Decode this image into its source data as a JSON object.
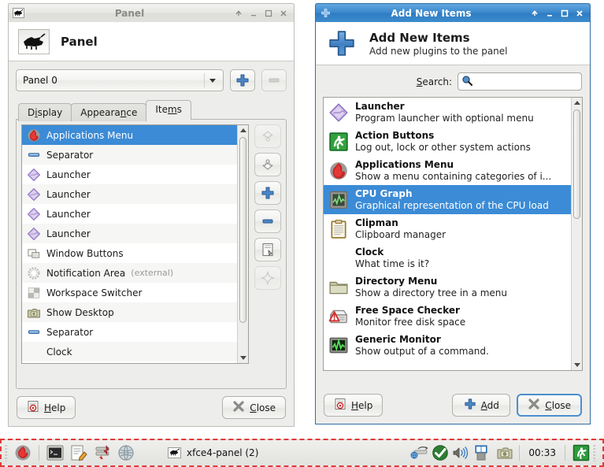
{
  "panel_window": {
    "titlebar": {
      "icon": "mouse-icon",
      "title": "Panel",
      "buttons": [
        {
          "name": "shade-button",
          "glyph": "↑"
        },
        {
          "name": "minimize-button",
          "glyph": "_"
        },
        {
          "name": "maximize-button",
          "glyph": "□"
        },
        {
          "name": "close-button",
          "glyph": "✕"
        }
      ]
    },
    "header": {
      "icon": "mouse-icon",
      "title": "Panel"
    },
    "panel_selector": {
      "value": "Panel 0",
      "add_panel_label": "add-panel",
      "remove_panel_label": "remove-panel"
    },
    "tabs": [
      {
        "label": "Display",
        "accel": "i",
        "selected": false
      },
      {
        "label": "Appearance",
        "accel": "n",
        "selected": false
      },
      {
        "label": "Items",
        "accel": "m",
        "selected": true
      }
    ],
    "items": [
      {
        "label": "Applications Menu",
        "icon": "applications-menu-icon",
        "selected": true,
        "extra": ""
      },
      {
        "label": "Separator",
        "icon": "separator-icon",
        "selected": false,
        "extra": ""
      },
      {
        "label": "Launcher",
        "icon": "launcher-icon",
        "selected": false,
        "extra": ""
      },
      {
        "label": "Launcher",
        "icon": "launcher-icon",
        "selected": false,
        "extra": ""
      },
      {
        "label": "Launcher",
        "icon": "launcher-icon",
        "selected": false,
        "extra": ""
      },
      {
        "label": "Launcher",
        "icon": "launcher-icon",
        "selected": false,
        "extra": ""
      },
      {
        "label": "Window Buttons",
        "icon": "window-buttons-icon",
        "selected": false,
        "extra": ""
      },
      {
        "label": "Notification Area",
        "icon": "notification-area-icon",
        "selected": false,
        "extra": "(external)"
      },
      {
        "label": "Workspace Switcher",
        "icon": "workspace-switcher-icon",
        "selected": false,
        "extra": ""
      },
      {
        "label": "Show Desktop",
        "icon": "show-desktop-icon",
        "selected": false,
        "extra": ""
      },
      {
        "label": "Separator",
        "icon": "separator-icon",
        "selected": false,
        "extra": ""
      },
      {
        "label": "Clock",
        "icon": "clock-icon",
        "selected": false,
        "extra": ""
      }
    ],
    "side_buttons": [
      {
        "name": "move-up-button",
        "icon": "chevron-up-icon",
        "enabled": false
      },
      {
        "name": "move-down-button",
        "icon": "chevron-down-icon",
        "enabled": true
      },
      {
        "name": "add-item-button",
        "icon": "plus-icon",
        "enabled": true
      },
      {
        "name": "remove-item-button",
        "icon": "minus-icon",
        "enabled": true
      },
      {
        "name": "item-properties-button",
        "icon": "properties-icon",
        "enabled": true
      },
      {
        "name": "item-about-button",
        "icon": "star-icon",
        "enabled": false
      }
    ],
    "footer": {
      "help_label": "Help",
      "help_accel": "H",
      "close_label": "Close",
      "close_accel": "C"
    }
  },
  "add_items_window": {
    "titlebar": {
      "icon": "plus-icon",
      "title": "Add New Items",
      "buttons": [
        {
          "name": "shade-button",
          "glyph": "↑"
        },
        {
          "name": "minimize-button",
          "glyph": "_"
        },
        {
          "name": "maximize-button",
          "glyph": "□"
        },
        {
          "name": "close-button",
          "glyph": "✕"
        }
      ]
    },
    "header": {
      "icon": "plus-icon",
      "title": "Add New Items",
      "subtitle": "Add new plugins to the panel"
    },
    "search": {
      "label": "Search:",
      "accel": "S",
      "value": "",
      "placeholder": "",
      "icon": "search-icon"
    },
    "plugins": [
      {
        "name": "Launcher",
        "desc": "Program launcher with optional menu",
        "icon": "launcher-icon",
        "selected": false
      },
      {
        "name": "Action Buttons",
        "desc": "Log out, lock or other system actions",
        "icon": "action-buttons-icon",
        "selected": false
      },
      {
        "name": "Applications Menu",
        "desc": "Show a menu containing categories of i...",
        "icon": "applications-menu-icon",
        "selected": false
      },
      {
        "name": "CPU Graph",
        "desc": "Graphical representation of the CPU load",
        "icon": "cpu-graph-icon",
        "selected": true
      },
      {
        "name": "Clipman",
        "desc": "Clipboard manager",
        "icon": "clipman-icon",
        "selected": false
      },
      {
        "name": "Clock",
        "desc": "What time is it?",
        "icon": "",
        "selected": false
      },
      {
        "name": "Directory Menu",
        "desc": "Show a directory tree in a menu",
        "icon": "directory-menu-icon",
        "selected": false
      },
      {
        "name": "Free Space Checker",
        "desc": "Monitor free disk space",
        "icon": "free-space-checker-icon",
        "selected": false
      },
      {
        "name": "Generic Monitor",
        "desc": "Show output of a command.",
        "icon": "generic-monitor-icon",
        "selected": false
      }
    ],
    "footer": {
      "help_label": "Help",
      "help_accel": "H",
      "add_label": "Add",
      "add_accel": "A",
      "close_label": "Close",
      "close_accel": "C"
    }
  },
  "taskbar": {
    "launchers": [
      {
        "name": "applications-menu-icon"
      },
      {
        "name": "terminal-icon"
      },
      {
        "name": "text-editor-icon"
      },
      {
        "name": "file-manager-icon"
      },
      {
        "name": "web-browser-icon"
      }
    ],
    "window_button": {
      "icon": "mouse-icon",
      "label": "xfce4-panel (2)"
    },
    "tray": [
      {
        "name": "network-icon"
      },
      {
        "name": "update-icon"
      },
      {
        "name": "volume-icon"
      },
      {
        "name": "workspace-switcher-icon"
      },
      {
        "name": "screenshot-icon"
      }
    ],
    "clock": "00:33",
    "logout": {
      "name": "logout-icon"
    }
  },
  "colors": {
    "selection": "#3b8bd6",
    "active_titlebar": "#3a88cc",
    "inactive_titlebar": "#e6e6e3",
    "window_bg": "#ededeb",
    "panel_border_highlight": "#e03a3a"
  }
}
